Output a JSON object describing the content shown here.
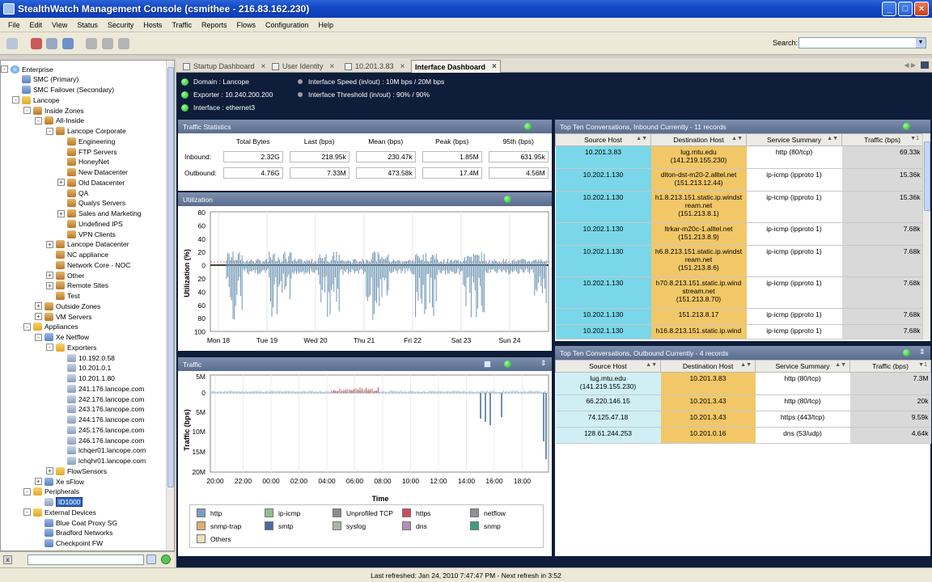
{
  "window": {
    "title": "StealthWatch Management Console (csmithee - 216.83.162.230)"
  },
  "menu": [
    "File",
    "Edit",
    "View",
    "Status",
    "Security",
    "Hosts",
    "Traffic",
    "Reports",
    "Flows",
    "Configuration",
    "Help"
  ],
  "toolbar": {
    "search_label": "Search:",
    "search_value": ""
  },
  "tree": [
    {
      "label": "Enterprise",
      "icon": "globe",
      "exp": "-"
    },
    {
      "label": "SMC (Primary)",
      "icon": "server",
      "exp": ""
    },
    {
      "label": "SMC Failover (Secondary)",
      "icon": "server",
      "exp": ""
    },
    {
      "label": "Lancope",
      "icon": "folder",
      "exp": "-"
    },
    {
      "label": "Inside Zones",
      "icon": "group",
      "exp": "-"
    },
    {
      "label": "All-Inside",
      "icon": "group",
      "exp": "-"
    },
    {
      "label": "Lancope Corporate",
      "icon": "group",
      "exp": "-"
    },
    {
      "label": "Engineering",
      "icon": "group",
      "exp": ""
    },
    {
      "label": "FTP Servers",
      "icon": "group",
      "exp": ""
    },
    {
      "label": "HoneyNet",
      "icon": "group",
      "exp": ""
    },
    {
      "label": "New Datacenter",
      "icon": "group",
      "exp": ""
    },
    {
      "label": "Old Datacenter",
      "icon": "group",
      "exp": "+"
    },
    {
      "label": "QA",
      "icon": "group",
      "exp": ""
    },
    {
      "label": "Qualys Servers",
      "icon": "group",
      "exp": ""
    },
    {
      "label": "Sales and Marketing",
      "icon": "group",
      "exp": "+"
    },
    {
      "label": "Undefined IPS",
      "icon": "group",
      "exp": ""
    },
    {
      "label": "VPN Clients",
      "icon": "group",
      "exp": ""
    },
    {
      "label": "Lancope Datacenter",
      "icon": "group",
      "exp": "+"
    },
    {
      "label": "NC appliance",
      "icon": "group",
      "exp": ""
    },
    {
      "label": "Network Core - NOC",
      "icon": "group",
      "exp": ""
    },
    {
      "label": "Other",
      "icon": "group",
      "exp": "+"
    },
    {
      "label": "Remote Sites",
      "icon": "group",
      "exp": "+"
    },
    {
      "label": "Test",
      "icon": "group",
      "exp": ""
    },
    {
      "label": "Outside Zones",
      "icon": "group",
      "exp": "+"
    },
    {
      "label": "VM Servers",
      "icon": "group",
      "exp": "+"
    },
    {
      "label": "Appliances",
      "icon": "folder",
      "exp": "-"
    },
    {
      "label": "Xe Netflow",
      "icon": "server",
      "exp": "-"
    },
    {
      "label": "Exporters",
      "icon": "folder",
      "exp": "-"
    },
    {
      "label": "10.192.0.58",
      "icon": "host",
      "exp": ""
    },
    {
      "label": "10.201.0.1",
      "icon": "host",
      "exp": ""
    },
    {
      "label": "10.201.1.80",
      "icon": "host",
      "exp": ""
    },
    {
      "label": "241.176.lancope.com",
      "icon": "host",
      "exp": ""
    },
    {
      "label": "242.176.lancope.com",
      "icon": "host",
      "exp": ""
    },
    {
      "label": "243.176.lancope.com",
      "icon": "host",
      "exp": ""
    },
    {
      "label": "244.176.lancope.com",
      "icon": "host",
      "exp": ""
    },
    {
      "label": "245.176.lancope.com",
      "icon": "host",
      "exp": ""
    },
    {
      "label": "246.176.lancope.com",
      "icon": "host",
      "exp": ""
    },
    {
      "label": "lchqer01.lancope.com",
      "icon": "host",
      "exp": ""
    },
    {
      "label": "lchqhr01.lancope.com",
      "icon": "host",
      "exp": ""
    },
    {
      "label": "FlowSensors",
      "icon": "folder",
      "exp": "+"
    },
    {
      "label": "Xe sFlow",
      "icon": "server",
      "exp": "+"
    },
    {
      "label": "Peripherals",
      "icon": "folder",
      "exp": "-"
    },
    {
      "label": "ID1000",
      "icon": "host",
      "exp": "",
      "selected": true
    },
    {
      "label": "External Devices",
      "icon": "folder",
      "exp": "-"
    },
    {
      "label": "Blue Coat Proxy SG",
      "icon": "server",
      "exp": ""
    },
    {
      "label": "Bradford Networks",
      "icon": "server",
      "exp": ""
    },
    {
      "label": "Checkpoint FW",
      "icon": "server",
      "exp": ""
    }
  ],
  "tabs": [
    {
      "label": "Startup Dashboard"
    },
    {
      "label": "User Identity"
    },
    {
      "label": "10.201.3.83"
    },
    {
      "label": "Interface Dashboard",
      "active": true
    }
  ],
  "info": {
    "domain": "Domain : Lancope",
    "exporter": "Exporter : 10.240.200.200",
    "interface": "Interface : ethernet3",
    "speed": "Interface Speed (in/out) : 10M bps / 20M bps",
    "threshold": "Interface Threshold (in/out) : 90% / 90%"
  },
  "stats": {
    "title": "Traffic Statistics",
    "headers": [
      "Total Bytes",
      "Last (bps)",
      "Mean (bps)",
      "Peak (bps)",
      "95th (bps)"
    ],
    "rows": [
      {
        "label": "Inbound:",
        "values": [
          "2.32G",
          "218.95k",
          "230.47k",
          "1.85M",
          "631.95k"
        ]
      },
      {
        "label": "Outbound:",
        "values": [
          "4.76G",
          "7.33M",
          "473.58k",
          "17.4M",
          "4.56M"
        ]
      }
    ]
  },
  "utilization": {
    "title": "Utilization",
    "ylabel": "Utilization (%)",
    "yticks": [
      "80",
      "60",
      "40",
      "20",
      "0",
      "20",
      "40",
      "60",
      "80",
      "100"
    ],
    "xticks": [
      "Mon 18",
      "Tue 19",
      "Wed 20",
      "Thu 21",
      "Fri 22",
      "Sat 23",
      "Sun 24"
    ]
  },
  "traffic": {
    "title": "Traffic",
    "ylabel": "Traffic (bps)",
    "xlabel": "Time",
    "yticks": [
      "5M",
      "0",
      "5M",
      "10M",
      "15M",
      "20M"
    ],
    "xticks": [
      "20:00",
      "22:00",
      "00:00",
      "02:00",
      "04:00",
      "06:00",
      "08:00",
      "10:00",
      "12:00",
      "14:00",
      "16:00",
      "18:00"
    ],
    "legend": [
      {
        "label": "http",
        "color": "#7a9cc4"
      },
      {
        "label": "ip-icmp",
        "color": "#8fc08f"
      },
      {
        "label": "Unprofiled TCP",
        "color": "#8a8a8a"
      },
      {
        "label": "https",
        "color": "#d04a5a"
      },
      {
        "label": "netflow",
        "color": "#8c9096"
      },
      {
        "label": "snmp-trap",
        "color": "#d8b070"
      },
      {
        "label": "smtp",
        "color": "#4a6aa0"
      },
      {
        "label": "syslog",
        "color": "#a8b8a0"
      },
      {
        "label": "dns",
        "color": "#b090b8"
      },
      {
        "label": "snmp",
        "color": "#3aa07a"
      },
      {
        "label": "Others",
        "color": "#e6e0c0"
      }
    ]
  },
  "inbound": {
    "title": "Top Ten Conversations, Inbound Currently - 11 records",
    "headers": [
      "Source Host",
      "Destination Host",
      "Service Summary",
      "Traffic (bps)"
    ],
    "rows": [
      {
        "src": "10.201.3.83",
        "dst": [
          "lug.mtu.edu",
          "(141.219.155.230)"
        ],
        "svc": "http (80/tcp)",
        "trf": "69.33k"
      },
      {
        "src": "10.202.1.130",
        "dst": [
          "dlton-dst-m20-2.alltel.net",
          "(151.213.12.44)"
        ],
        "svc": "ip-icmp (ipproto 1)",
        "trf": "15.36k"
      },
      {
        "src": "10.202.1.130",
        "dst": [
          "h1.8.213.151.static.ip.windst",
          "ream.net",
          "(151.213.8.1)"
        ],
        "svc": "ip-icmp (ipproto 1)",
        "trf": "15.36k"
      },
      {
        "src": "10.202.1.130",
        "dst": [
          "ltrkar-m20c-1.alltel.net",
          "(151.213.8.9)"
        ],
        "svc": "ip-icmp (ipproto 1)",
        "trf": "7.68k"
      },
      {
        "src": "10.202.1.130",
        "dst": [
          "h6.8.213.151.static.ip.windst",
          "ream.net",
          "(151.213.8.6)"
        ],
        "svc": "ip-icmp (ipproto 1)",
        "trf": "7.68k"
      },
      {
        "src": "10.202.1.130",
        "dst": [
          "h70.8.213.151.static.ip.wind",
          "stream.net",
          "(151.213.8.70)"
        ],
        "svc": "ip-icmp (ipproto 1)",
        "trf": "7.68k"
      },
      {
        "src": "10.202.1.130",
        "dst": [
          "151.213.8.17"
        ],
        "svc": "ip-icmp (ipproto 1)",
        "trf": "7.68k"
      },
      {
        "src": "10.202.1.130",
        "dst": [
          "h16.8.213.151.static.ip.wind"
        ],
        "svc": "ip-icmp (ipproto 1)",
        "trf": "7.68k"
      }
    ]
  },
  "outbound": {
    "title": "Top Ten Conversations, Outbound Currently - 4 records",
    "headers": [
      "Source Host",
      "Destination Host",
      "Service Summary",
      "Traffic (bps)"
    ],
    "rows": [
      {
        "src": [
          "lug.mtu.edu",
          "(141.219.155.230)"
        ],
        "dst": "10.201.3.83",
        "svc": "http (80/tcp)",
        "trf": "7.3M"
      },
      {
        "src": [
          "66.220.146.15"
        ],
        "dst": "10.201.3.43",
        "svc": "http (80/tcp)",
        "trf": "20k"
      },
      {
        "src": [
          "74.125.47.18"
        ],
        "dst": "10.201.3.43",
        "svc": "https (443/tcp)",
        "trf": "9.59k"
      },
      {
        "src": [
          "128.61.244.253"
        ],
        "dst": "10.201.0.16",
        "svc": "dns (53/udp)",
        "trf": "4.64k"
      }
    ]
  },
  "status": {
    "text": "Last refreshed: Jan 24, 2010 7:47:47 PM - Next refresh in 3:52"
  }
}
